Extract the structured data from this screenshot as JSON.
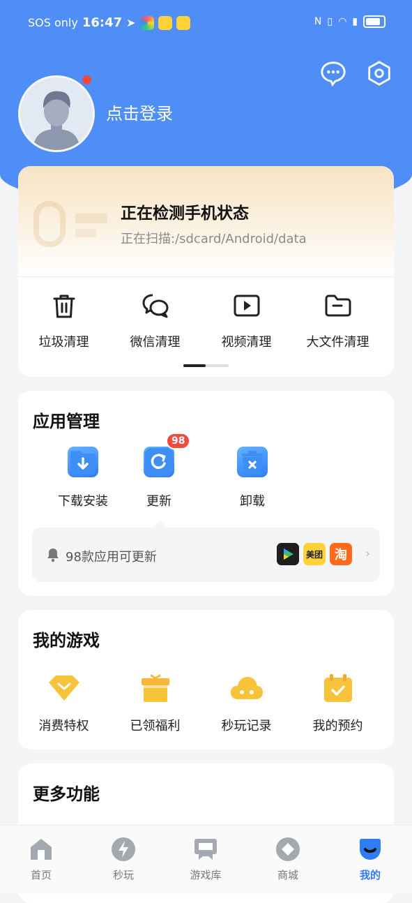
{
  "status_bar": {
    "carrier": "SOS only",
    "time": "16:47"
  },
  "header": {
    "login_text": "点击登录"
  },
  "scan": {
    "title": "正在检测手机状态",
    "subtitle": "正在扫描:/sdcard/Android/data"
  },
  "tools": [
    {
      "label": "垃圾清理",
      "icon": "trash-icon"
    },
    {
      "label": "微信清理",
      "icon": "chat-icon"
    },
    {
      "label": "视频清理",
      "icon": "video-icon"
    },
    {
      "label": "大文件清理",
      "icon": "folder-icon"
    }
  ],
  "apps": {
    "title": "应用管理",
    "items": [
      {
        "label": "下载安装",
        "icon": "download-icon"
      },
      {
        "label": "更新",
        "icon": "update-icon",
        "badge": "98"
      },
      {
        "label": "卸载",
        "icon": "uninstall-icon"
      }
    ],
    "update_text": "98款应用可更新",
    "update_apps": [
      "美团",
      "淘"
    ]
  },
  "games": {
    "title": "我的游戏",
    "items": [
      {
        "label": "消费特权",
        "icon": "diamond-icon"
      },
      {
        "label": "已领福利",
        "icon": "gift-icon"
      },
      {
        "label": "秒玩记录",
        "icon": "cloud-game-icon"
      },
      {
        "label": "我的预约",
        "icon": "calendar-check-icon"
      }
    ]
  },
  "more": {
    "title": "更多功能"
  },
  "tabs": [
    {
      "label": "首页",
      "icon": "home-icon"
    },
    {
      "label": "秒玩",
      "icon": "lightning-icon"
    },
    {
      "label": "游戏库",
      "icon": "game-library-icon"
    },
    {
      "label": "商城",
      "icon": "store-icon"
    },
    {
      "label": "我的",
      "icon": "profile-icon",
      "active": true
    }
  ],
  "colors": {
    "primary": "#4f8ef7",
    "badge": "#ef4a3b",
    "game_yellow": "#f7c33a"
  }
}
